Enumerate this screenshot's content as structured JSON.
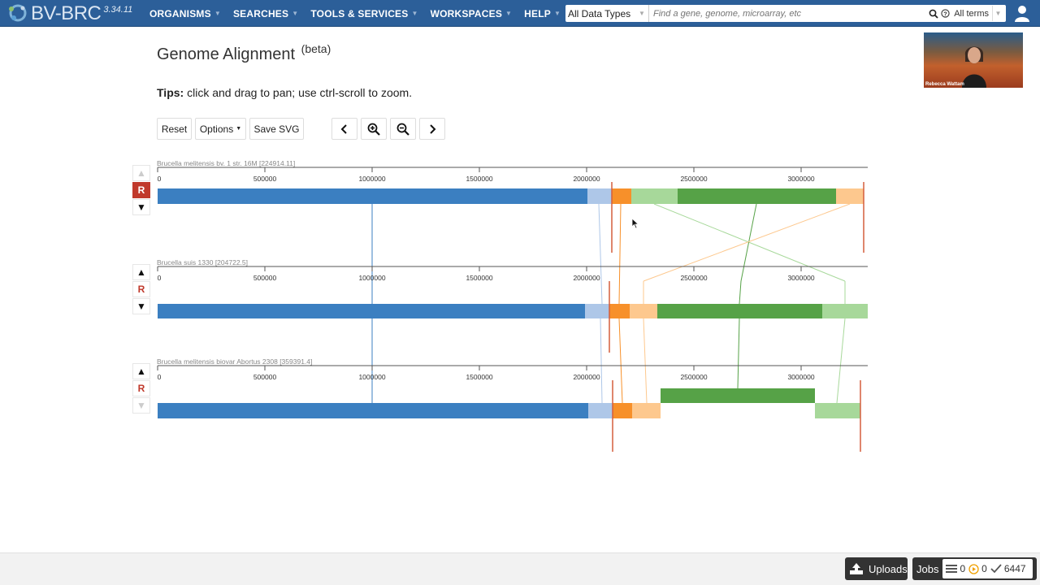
{
  "header": {
    "logo_text": "BV-BRC",
    "version": "3.34.11",
    "nav": [
      "ORGANISMS",
      "SEARCHES",
      "TOOLS & SERVICES",
      "WORKSPACES",
      "HELP"
    ],
    "search": {
      "data_type": "All Data Types",
      "placeholder": "Find a gene, genome, microarray, etc",
      "terms": "All terms"
    }
  },
  "page": {
    "title": "Genome Alignment",
    "title_sup": "(beta)",
    "tips_label": "Tips:",
    "tips_text": " click and drag to pan; use ctrl-scroll to zoom."
  },
  "toolbar": {
    "reset": "Reset",
    "options": "Options",
    "save_svg": "Save SVG"
  },
  "video": {
    "name": "Rebecca Wattam"
  },
  "alignment": {
    "axis_ticks": [
      "0",
      "500000",
      "1000000",
      "1500000",
      "2000000",
      "2500000",
      "3000000"
    ],
    "reverse_label": "R",
    "genomes": [
      {
        "name": "Brucella melitensis bv. 1 str. 16M [224914.11]",
        "up_disabled": true,
        "down_disabled": false,
        "r_active": true
      },
      {
        "name": "Brucella suis 1330 [204722.5]",
        "up_disabled": false,
        "down_disabled": false,
        "r_active": false
      },
      {
        "name": "Brucella melitensis biovar Abortus 2308 [359391.4]",
        "up_disabled": false,
        "down_disabled": true,
        "r_active": false
      }
    ],
    "block_colors": {
      "blue": "#3b7fc1",
      "light_blue": "#aec7e8",
      "orange": "#f7902a",
      "light_orange": "#fdc88e",
      "light_green": "#a7d89a",
      "green": "#56a247",
      "red": "#d45d3c"
    }
  },
  "footer": {
    "uploads": "Uploads",
    "jobs": "Jobs",
    "queued": "0",
    "running": "0",
    "completed": "6447"
  }
}
